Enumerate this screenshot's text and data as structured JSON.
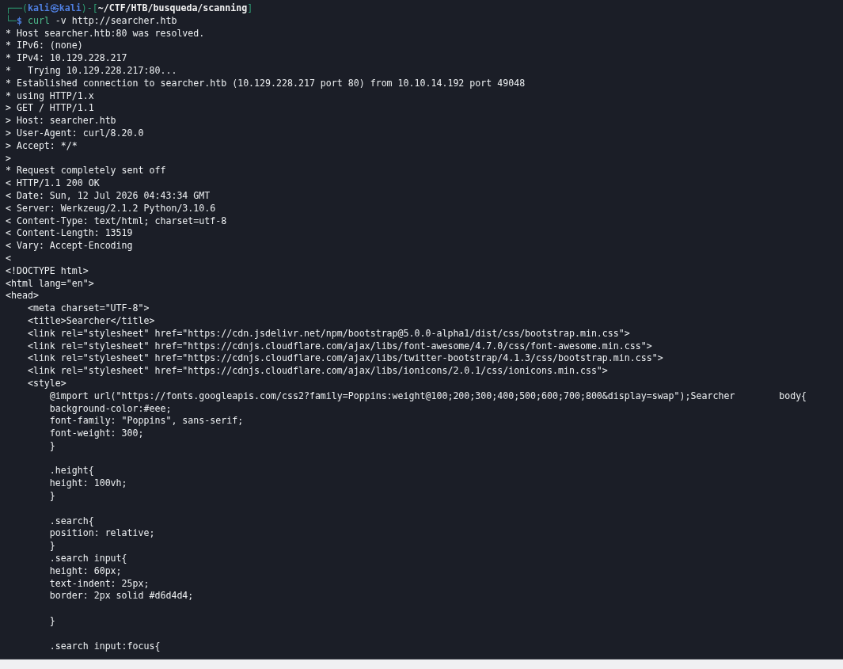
{
  "terminal": {
    "prompt": {
      "frame_top": "┌──(",
      "user_host": "kali㉿kali",
      "separator": ")-[",
      "path": "~/CTF/HTB/busqueda/scanning",
      "bracket_close": "]"
    },
    "command_line": {
      "frame_bottom": "└─",
      "symbol": "$",
      "command": "curl",
      "arguments": "-v http://searcher.htb"
    },
    "lines": [
      {
        "kind": "text",
        "text": "* Host searcher.htb:80 was resolved."
      },
      {
        "kind": "text",
        "text": "* IPv6: (none)"
      },
      {
        "kind": "text",
        "text": "* IPv4: 10.129.228.217"
      },
      {
        "kind": "text",
        "text": "*   Trying 10.129.228.217:80..."
      },
      {
        "kind": "text",
        "text": "* Established connection to searcher.htb (10.129.228.217 port 80) from 10.10.14.192 port 49048"
      },
      {
        "kind": "text",
        "text": "* using HTTP/1.x"
      },
      {
        "kind": "text",
        "text": "> GET / HTTP/1.1"
      },
      {
        "kind": "text",
        "text": "> Host: searcher.htb"
      },
      {
        "kind": "text",
        "text": "> User-Agent: curl/8.20.0"
      },
      {
        "kind": "text",
        "text": "> Accept: */*"
      },
      {
        "kind": "text",
        "text": ">"
      },
      {
        "kind": "text",
        "text": "* Request completely sent off"
      },
      {
        "kind": "text",
        "text": "< HTTP/1.1 200 OK"
      },
      {
        "kind": "text",
        "text": "< Date: Sun, 12 Jul 2026 04:43:34 GMT"
      },
      {
        "kind": "text",
        "text": "< Server: Werkzeug/2.1.2 Python/3.10.6"
      },
      {
        "kind": "text",
        "text": "< Content-Type: text/html; charset=utf-8"
      },
      {
        "kind": "text",
        "text": "< Content-Length: 13519"
      },
      {
        "kind": "text",
        "text": "< Vary: Accept-Encoding"
      },
      {
        "kind": "text",
        "text": "<"
      },
      {
        "kind": "text",
        "text": "<!DOCTYPE html>"
      },
      {
        "kind": "text",
        "text": "<html lang=\"en\">"
      },
      {
        "kind": "text",
        "text": "<head>"
      },
      {
        "kind": "text",
        "text": "    <meta charset=\"UTF-8\">"
      },
      {
        "kind": "text",
        "text": "    <title>Searcher</title>"
      },
      {
        "kind": "text",
        "text": "    <link rel=\"stylesheet\" href=\"https://cdn.jsdelivr.net/npm/bootstrap@5.0.0-alpha1/dist/css/bootstrap.min.css\">"
      },
      {
        "kind": "text",
        "text": "    <link rel=\"stylesheet\" href=\"https://cdnjs.cloudflare.com/ajax/libs/font-awesome/4.7.0/css/font-awesome.min.css\">"
      },
      {
        "kind": "text",
        "text": "    <link rel=\"stylesheet\" href=\"https://cdnjs.cloudflare.com/ajax/libs/twitter-bootstrap/4.1.3/css/bootstrap.min.css\">"
      },
      {
        "kind": "text",
        "text": "    <link rel=\"stylesheet\" href=\"https://cdnjs.cloudflare.com/ajax/libs/ionicons/2.0.1/css/ionicons.min.css\">"
      },
      {
        "kind": "text",
        "text": "    <style>"
      },
      {
        "kind": "text",
        "text": "        @import url(\"https://fonts.googleapis.com/css2?family=Poppins:weight@100;200;300;400;500;600;700;800&display=swap\");Searcher        body{"
      },
      {
        "kind": "text",
        "text": "        background-color:#eee;"
      },
      {
        "kind": "text",
        "text": "        font-family: \"Poppins\", sans-serif;"
      },
      {
        "kind": "text",
        "text": "        font-weight: 300;"
      },
      {
        "kind": "text",
        "text": "        }"
      },
      {
        "kind": "blank"
      },
      {
        "kind": "text",
        "text": "        .height{"
      },
      {
        "kind": "text",
        "text": "        height: 100vh;"
      },
      {
        "kind": "text",
        "text": "        }"
      },
      {
        "kind": "blank"
      },
      {
        "kind": "text",
        "text": "        .search{"
      },
      {
        "kind": "text",
        "text": "        position: relative;"
      },
      {
        "kind": "text",
        "text": "        }"
      },
      {
        "kind": "text",
        "text": "        .search input{"
      },
      {
        "kind": "text",
        "text": "        height: 60px;"
      },
      {
        "kind": "text",
        "text": "        text-indent: 25px;"
      },
      {
        "kind": "text",
        "text": "        border: 2px solid #d6d4d4;"
      },
      {
        "kind": "blank"
      },
      {
        "kind": "text",
        "text": "        }"
      },
      {
        "kind": "blank"
      },
      {
        "kind": "text",
        "text": "        .search input:focus{"
      }
    ]
  }
}
